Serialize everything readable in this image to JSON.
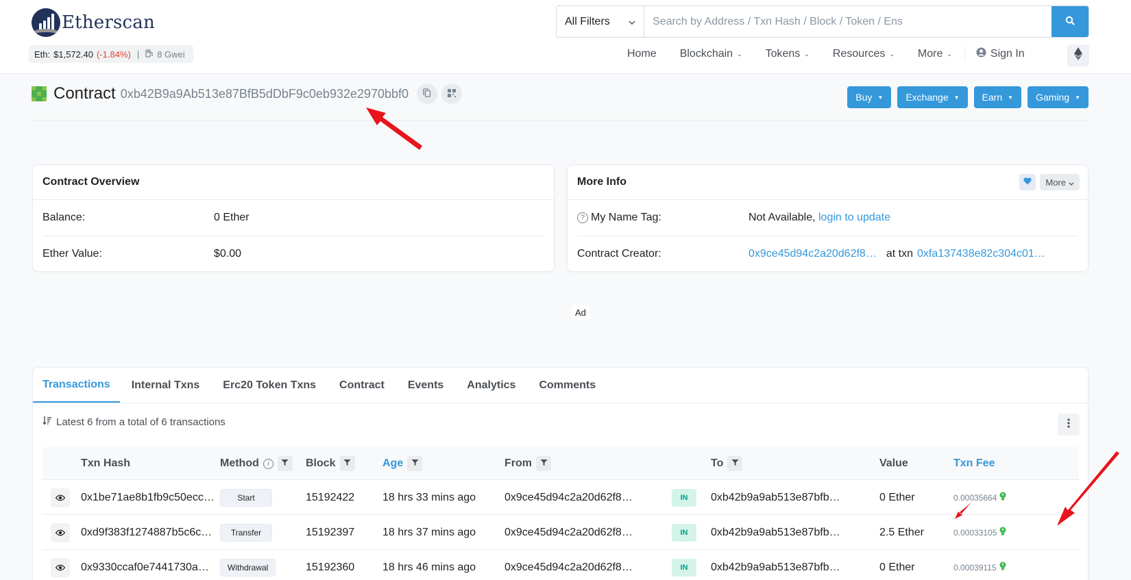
{
  "brand": {
    "name": "Etherscan"
  },
  "price": {
    "label": "Eth:",
    "value": "$1,572.40",
    "change": "(-1.84%)",
    "separator": "|",
    "gas": "8 Gwei"
  },
  "search": {
    "filter": "All Filters",
    "placeholder": "Search by Address / Txn Hash / Block / Token / Ens"
  },
  "nav": {
    "home": "Home",
    "blockchain": "Blockchain",
    "tokens": "Tokens",
    "resources": "Resources",
    "more": "More",
    "signin": "Sign In"
  },
  "contract": {
    "label": "Contract",
    "address": "0xb42B9a9Ab513e87BfB5dDbF9c0eb932e2970bbf0"
  },
  "actions": {
    "buy": "Buy",
    "exchange": "Exchange",
    "earn": "Earn",
    "gaming": "Gaming"
  },
  "overview": {
    "title": "Contract Overview",
    "balance_label": "Balance:",
    "balance_value": "0 Ether",
    "ether_value_label": "Ether Value:",
    "ether_value": "$0.00"
  },
  "more_info": {
    "title": "More Info",
    "more_btn": "More",
    "name_tag_label": "My Name Tag:",
    "name_tag_value": "Not Available,",
    "name_tag_link": "login to update",
    "creator_label": "Contract Creator:",
    "creator_address": "0x9ce45d94c2a20d62f8…",
    "at_txn": "at txn",
    "creator_txn": "0xfa137438e82c304c01…"
  },
  "ad": "Ad",
  "tabs": [
    "Transactions",
    "Internal Txns",
    "Erc20 Token Txns",
    "Contract",
    "Events",
    "Analytics",
    "Comments"
  ],
  "summary": "Latest 6 from a total of 6 transactions",
  "table": {
    "headers": {
      "hash": "Txn Hash",
      "method": "Method",
      "block": "Block",
      "age": "Age",
      "from": "From",
      "to": "To",
      "value": "Value",
      "fee": "Txn Fee"
    },
    "rows": [
      {
        "hash": "0x1be71ae8b1fb9c50ecc…",
        "method": "Start",
        "block": "15192422",
        "age": "18 hrs 33 mins ago",
        "from": "0x9ce45d94c2a20d62f8…",
        "dir": "IN",
        "to": "0xb42b9a9ab513e87bfb…",
        "value": "0 Ether",
        "fee": "0.00035664"
      },
      {
        "hash": "0xd9f383f1274887b5c6c…",
        "method": "Transfer",
        "block": "15192397",
        "age": "18 hrs 37 mins ago",
        "from": "0x9ce45d94c2a20d62f8…",
        "dir": "IN",
        "to": "0xb42b9a9ab513e87bfb…",
        "value": "2.5 Ether",
        "fee": "0.00033105"
      },
      {
        "hash": "0x9330ccaf0e7441730a…",
        "method": "Withdrawal",
        "block": "15192360",
        "age": "18 hrs 46 mins ago",
        "from": "0x9ce45d94c2a20d62f8…",
        "dir": "IN",
        "to": "0xb42b9a9ab513e87bfb…",
        "value": "0 Ether",
        "fee": "0.00039115"
      }
    ]
  },
  "colors": {
    "accent": "#3498db",
    "brand": "#21325b",
    "negative": "#de4437",
    "in_badge": "#00a186",
    "annotation": "#e8141c"
  },
  "icons": [
    "search-icon",
    "copy-icon",
    "qr-code-icon",
    "user-icon",
    "ethereum-icon",
    "heart-icon",
    "question-icon",
    "sort-icon",
    "kebab-icon",
    "filter-icon",
    "info-icon",
    "eye-icon",
    "fee-indicator-icon",
    "chevron-down-icon",
    "arrow-annotation"
  ]
}
